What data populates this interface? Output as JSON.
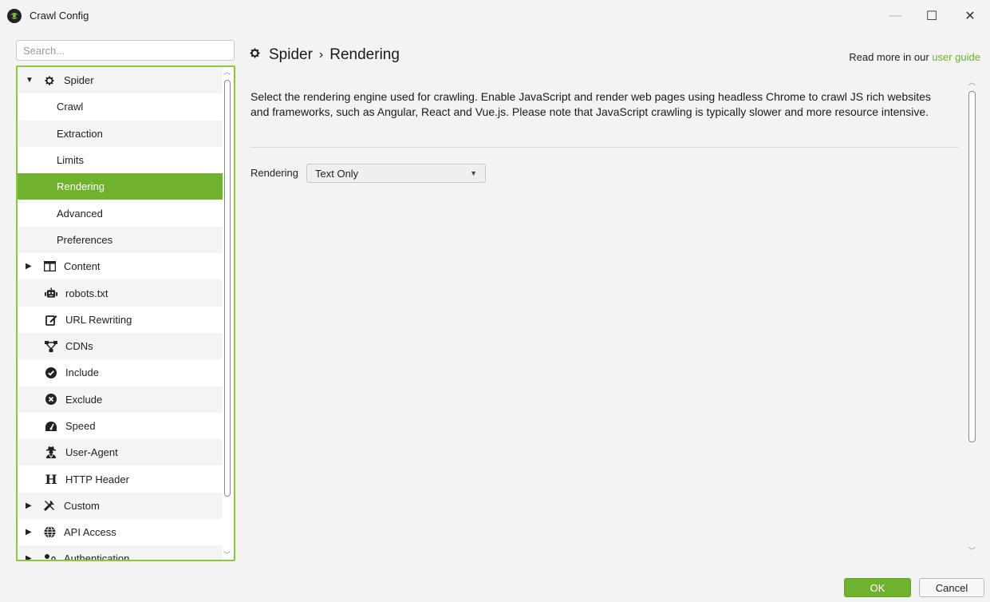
{
  "window": {
    "title": "Crawl Config",
    "minimize": "—",
    "maximize": "☐",
    "close": "✕"
  },
  "search": {
    "placeholder": "Search..."
  },
  "tree": {
    "items": [
      {
        "label": "Spider",
        "arrow": "▼",
        "icon": "gear-icon"
      },
      {
        "label": "Crawl"
      },
      {
        "label": "Extraction"
      },
      {
        "label": "Limits"
      },
      {
        "label": "Rendering",
        "selected": true
      },
      {
        "label": "Advanced"
      },
      {
        "label": "Preferences"
      },
      {
        "label": "Content",
        "arrow": "▶",
        "icon": "columns-icon"
      },
      {
        "label": "robots.txt",
        "icon": "robot-icon"
      },
      {
        "label": "URL Rewriting",
        "icon": "edit-icon"
      },
      {
        "label": "CDNs",
        "icon": "network-icon"
      },
      {
        "label": "Include",
        "icon": "check-circle-icon"
      },
      {
        "label": "Exclude",
        "icon": "x-circle-icon"
      },
      {
        "label": "Speed",
        "icon": "speedometer-icon"
      },
      {
        "label": "User-Agent",
        "icon": "user-secret-icon"
      },
      {
        "label": "HTTP Header",
        "icon": "header-h-icon"
      },
      {
        "label": "Custom",
        "arrow": "▶",
        "icon": "tools-icon"
      },
      {
        "label": "API Access",
        "arrow": "▶",
        "icon": "globe-icon"
      },
      {
        "label": "Authentication",
        "arrow": "▶",
        "icon": "user-lock-icon"
      }
    ]
  },
  "content": {
    "breadcrumb_parent": "Spider",
    "breadcrumb_sep": "›",
    "breadcrumb_current": "Rendering",
    "readmore_prefix": "Read more in our ",
    "readmore_link": "user guide",
    "description": "Select the rendering engine used for crawling. Enable JavaScript and render web pages using headless Chrome to crawl JS rich websites and frameworks, such as Angular, React and Vue.js. Please note that JavaScript crawling is typically slower and more resource intensive.",
    "rendering_label": "Rendering",
    "rendering_value": "Text Only"
  },
  "buttons": {
    "ok": "OK",
    "cancel": "Cancel"
  },
  "colors": {
    "accent": "#6fb22d",
    "border": "#8dc63f"
  }
}
